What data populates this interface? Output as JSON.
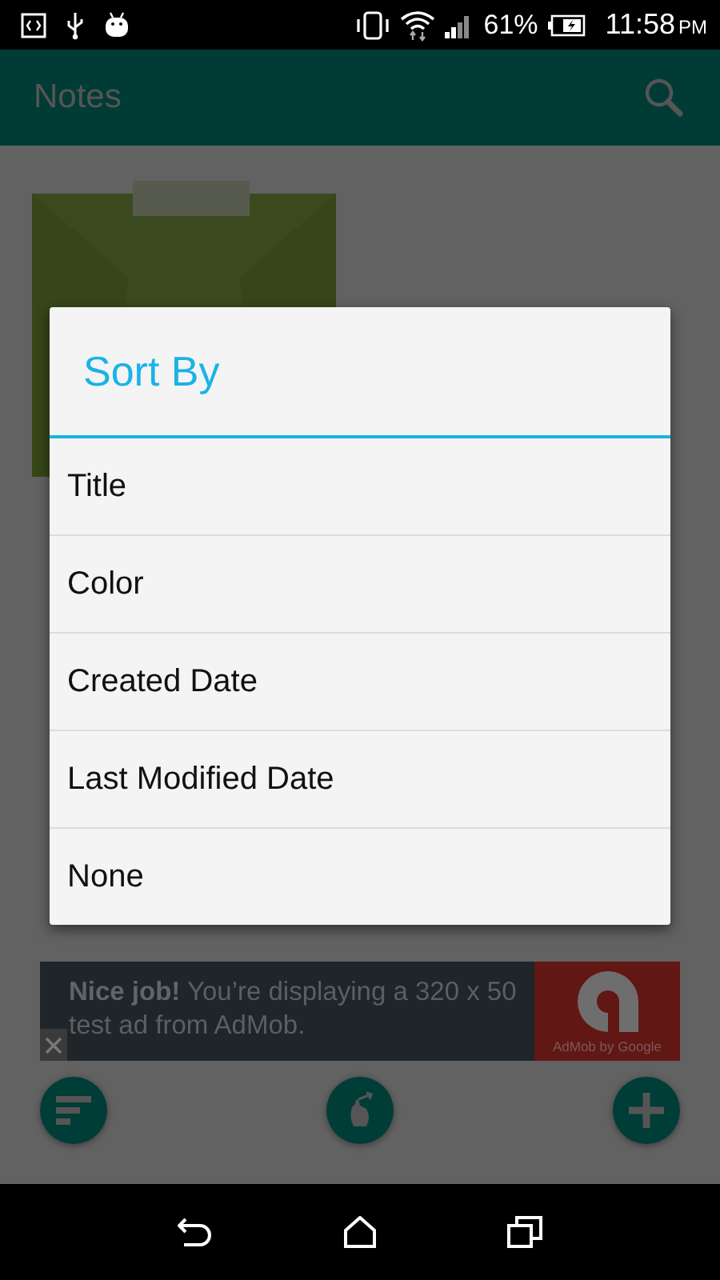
{
  "status_bar": {
    "battery": "61%",
    "time": "11:58",
    "time_suffix": "PM"
  },
  "app_bar": {
    "title": "Notes"
  },
  "dialog": {
    "title": "Sort By",
    "options": [
      {
        "label": "Title"
      },
      {
        "label": "Color"
      },
      {
        "label": "Created Date"
      },
      {
        "label": "Last Modified Date"
      },
      {
        "label": "None"
      }
    ]
  },
  "ad": {
    "text": "**Nice job!** You’re displaying a 320 x 50 test ad from AdMob.",
    "brand": "AdMob by Google"
  }
}
